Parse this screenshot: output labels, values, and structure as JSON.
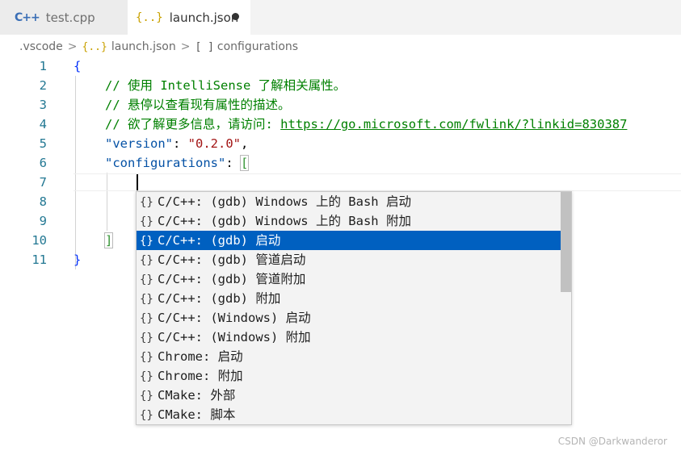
{
  "tabs": [
    {
      "label": "test.cpp",
      "icon": "cpp-icon",
      "icon_text": "C++"
    },
    {
      "label": "launch.json",
      "icon": "json-icon",
      "icon_text": "{..}",
      "dirty": true
    }
  ],
  "breadcrumb": {
    "folder": ".vscode",
    "file": "launch.json",
    "symbol": "configurations",
    "json_icon_text": "{..}",
    "array_icon_text": "[ ]",
    "separator": ">"
  },
  "line_numbers": [
    "1",
    "2",
    "3",
    "4",
    "5",
    "6",
    "7",
    "8",
    "9",
    "10",
    "11"
  ],
  "code": {
    "l1_brace": "{",
    "l2_comment": "// 使用 IntelliSense 了解相关属性。",
    "l3_comment": "// 悬停以查看现有属性的描述。",
    "l4_comment": "// 欲了解更多信息，请访问: ",
    "l4_link": "https://go.microsoft.com/fwlink/?linkid=830387",
    "l5_key": "\"version\"",
    "l5_colon": ": ",
    "l5_value": "\"0.2.0\"",
    "l5_comma": ",",
    "l6_key": "\"configurations\"",
    "l6_colon": ": ",
    "l6_bracket": "[",
    "l10_bracket": "]",
    "l11_brace": "}"
  },
  "suggest": {
    "icon_text": "{}",
    "selected_index": 2,
    "items": [
      "C/C++: (gdb) Windows 上的 Bash 启动",
      "C/C++: (gdb) Windows 上的 Bash 附加",
      "C/C++: (gdb) 启动",
      "C/C++: (gdb) 管道启动",
      "C/C++: (gdb) 管道附加",
      "C/C++: (gdb) 附加",
      "C/C++: (Windows) 启动",
      "C/C++: (Windows) 附加",
      "Chrome: 启动",
      "Chrome: 附加",
      "CMake: 外部",
      "CMake: 脚本"
    ]
  },
  "watermark": "CSDN @Darkwanderor",
  "colors": {
    "comment": "#008000",
    "key": "#0451a5",
    "string": "#a31515",
    "line_number": "#237893",
    "selection": "#0060c0"
  }
}
